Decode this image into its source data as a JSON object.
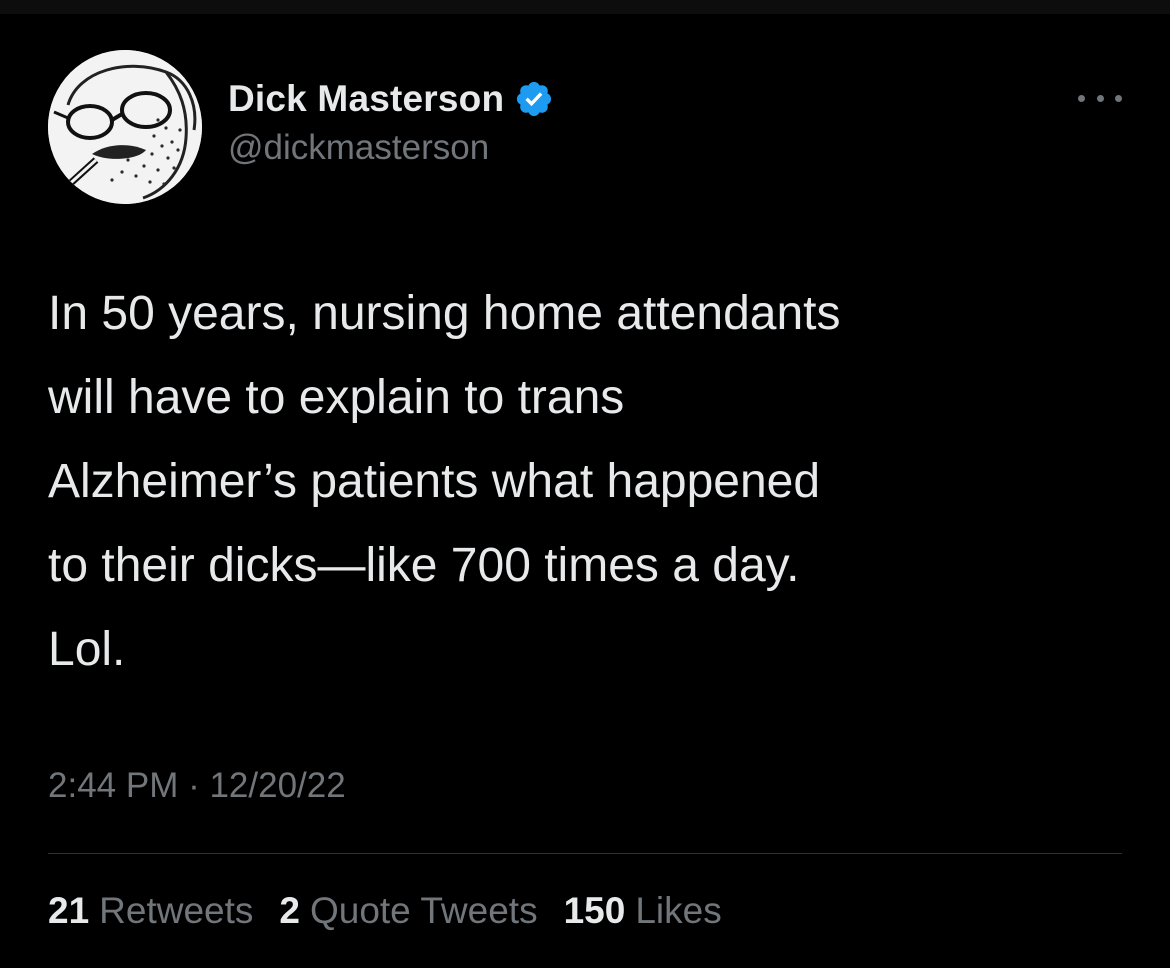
{
  "app": "Twitter",
  "author": {
    "display_name": "Dick Masterson",
    "handle": "@dickmasterson",
    "verified": true,
    "verified_icon": "verified-badge-icon",
    "avatar_description": "sketch-portrait-avatar"
  },
  "tweet": {
    "text": "In 50 years, nursing home attendants\nwill have to explain to trans\nAlzheimer’s patients what happened\nto their dicks—like 700 times a day.\nLol.",
    "timestamp": "2:44 PM · 12/20/22"
  },
  "stats": {
    "retweets_count": "21",
    "retweets_label": "Retweets",
    "quotes_count": "2",
    "quotes_label": "Quote Tweets",
    "likes_count": "150",
    "likes_label": "Likes"
  },
  "colors": {
    "background": "#000000",
    "text": "#e7e9ea",
    "secondary": "#71767b",
    "verified_blue": "#1d9bf0",
    "divider": "#2f3336"
  }
}
